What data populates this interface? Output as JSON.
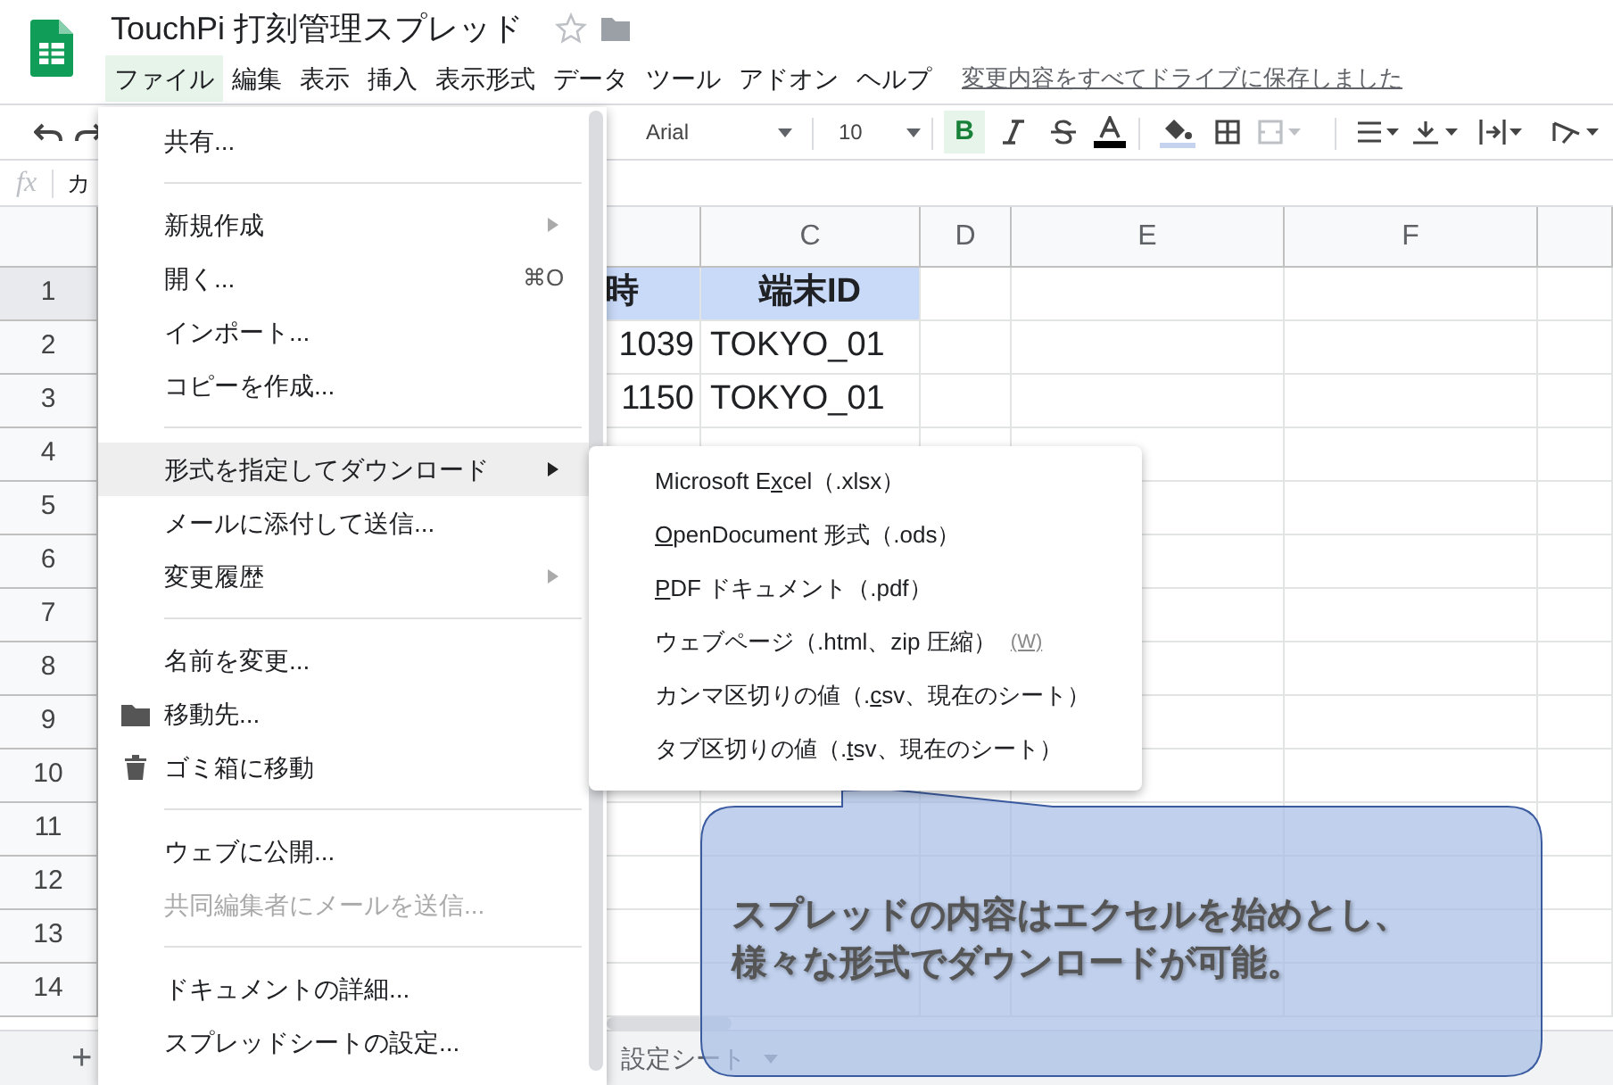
{
  "app": {
    "title": "TouchPi 打刻管理スプレッド",
    "starred": false
  },
  "menubar": [
    {
      "label": "ファイル",
      "selected": true
    },
    {
      "label": "編集",
      "selected": false
    },
    {
      "label": "表示",
      "selected": false
    },
    {
      "label": "挿入",
      "selected": false
    },
    {
      "label": "表示形式",
      "selected": false
    },
    {
      "label": "データ",
      "selected": false
    },
    {
      "label": "ツール",
      "selected": false
    },
    {
      "label": "アドオン",
      "selected": false
    },
    {
      "label": "ヘルプ",
      "selected": false
    }
  ],
  "save_status": "変更内容をすべてドライブに保存しました",
  "toolbar": {
    "font": "Arial",
    "font_size": "10",
    "bold": {
      "label": "B",
      "on": true
    }
  },
  "formula_bar": {
    "label": "fx",
    "value": "カ"
  },
  "grid": {
    "columns": [
      "C",
      "D",
      "E",
      "F"
    ],
    "rows": [
      {
        "number": "1",
        "selected": true,
        "header": true,
        "cells": [
          "時",
          "端末ID"
        ]
      },
      {
        "number": "2",
        "selected": false,
        "header": false,
        "cells": [
          "1039",
          "TOKYO_01"
        ]
      },
      {
        "number": "3",
        "selected": false,
        "header": false,
        "cells": [
          "1150",
          "TOKYO_01"
        ]
      },
      {
        "number": "4",
        "selected": false
      },
      {
        "number": "5",
        "selected": false
      },
      {
        "number": "6",
        "selected": false
      },
      {
        "number": "7",
        "selected": false
      },
      {
        "number": "8",
        "selected": false
      },
      {
        "number": "9",
        "selected": false
      },
      {
        "number": "10",
        "selected": false
      },
      {
        "number": "11",
        "selected": false
      },
      {
        "number": "12",
        "selected": false
      },
      {
        "number": "13",
        "selected": false
      },
      {
        "number": "14",
        "selected": false
      }
    ]
  },
  "add_sheet": "+",
  "sheet_tabs": [
    {
      "label": "設定シート",
      "selected": false
    }
  ],
  "file_menu": [
    {
      "kind": "item",
      "label": "共有...",
      "submenu": false,
      "disabled": false,
      "selected": false
    },
    {
      "kind": "separator"
    },
    {
      "kind": "item",
      "label": "新規作成",
      "submenu": true,
      "disabled": false,
      "selected": false
    },
    {
      "kind": "item",
      "label": "開く...",
      "shortcut": "⌘O",
      "submenu": false,
      "disabled": false,
      "selected": false
    },
    {
      "kind": "item",
      "label": "インポート...",
      "submenu": false,
      "disabled": false,
      "selected": false
    },
    {
      "kind": "item",
      "label": "コピーを作成...",
      "submenu": false,
      "disabled": false,
      "selected": false
    },
    {
      "kind": "separator"
    },
    {
      "kind": "item",
      "label": "形式を指定してダウンロード",
      "submenu": true,
      "disabled": false,
      "selected": true
    },
    {
      "kind": "item",
      "label": "メールに添付して送信...",
      "submenu": false,
      "disabled": false,
      "selected": false
    },
    {
      "kind": "item",
      "label": "変更履歴",
      "submenu": true,
      "disabled": false,
      "selected": false
    },
    {
      "kind": "separator"
    },
    {
      "kind": "item",
      "label": "名前を変更...",
      "submenu": false,
      "disabled": false,
      "selected": false
    },
    {
      "kind": "folder",
      "label": "移動先...",
      "submenu": false,
      "disabled": false,
      "selected": false
    },
    {
      "kind": "trash",
      "label": "ゴミ箱に移動",
      "submenu": false,
      "disabled": false,
      "selected": false
    },
    {
      "kind": "separator"
    },
    {
      "kind": "item",
      "label": "ウェブに公開...",
      "submenu": false,
      "disabled": false,
      "selected": false
    },
    {
      "kind": "item",
      "label": "共同編集者にメールを送信...",
      "submenu": false,
      "disabled": true,
      "selected": false
    },
    {
      "kind": "separator"
    },
    {
      "kind": "item",
      "label": "ドキュメントの詳細...",
      "submenu": false,
      "disabled": false,
      "selected": false
    },
    {
      "kind": "item",
      "label": "スプレッドシートの設定...",
      "submenu": false,
      "disabled": false,
      "selected": false
    }
  ],
  "download_submenu": [
    {
      "before": "Microsoft E",
      "key": "x",
      "after": "cel（.xlsx）"
    },
    {
      "key": "O",
      "after": "penDocument 形式（.ods）"
    },
    {
      "key": "P",
      "after": "DF ドキュメント（.pdf）"
    },
    {
      "before": "ウェブページ（.html、zip 圧縮）",
      "shortcut": "(W)"
    },
    {
      "before": "カンマ区切りの値（.",
      "key": "c",
      "after": "sv、現在のシート）"
    },
    {
      "before": "タブ区切りの値（.",
      "key": "t",
      "after": "sv、現在のシート）"
    }
  ],
  "callout": {
    "lines": [
      "スプレッドの内容はエクセルを始めとし、",
      "様々な形式でダウンロードが可能。"
    ]
  }
}
